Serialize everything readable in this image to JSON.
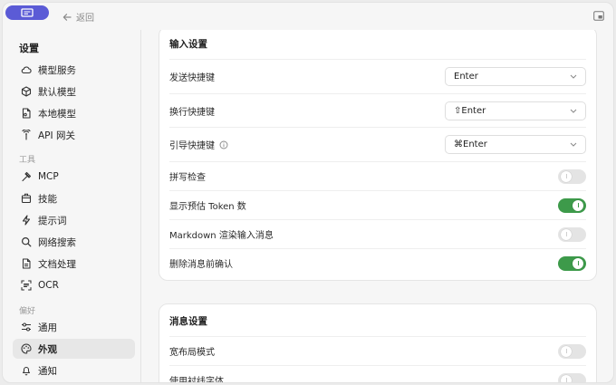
{
  "topbar": {
    "back_label": "返回"
  },
  "sidebar": {
    "title": "设置",
    "items_a": [
      {
        "label": "模型服务",
        "icon": "cloud-icon"
      },
      {
        "label": "默认模型",
        "icon": "cube-icon"
      },
      {
        "label": "本地模型",
        "icon": "document-icon"
      },
      {
        "label": "API 网关",
        "icon": "antenna-icon"
      }
    ],
    "group_tools": "工具",
    "items_b": [
      {
        "label": "MCP",
        "icon": "hammer-icon"
      },
      {
        "label": "技能",
        "icon": "box-icon"
      },
      {
        "label": "提示词",
        "icon": "lightning-icon"
      },
      {
        "label": "网络搜索",
        "icon": "search-icon"
      },
      {
        "label": "文档处理",
        "icon": "file-icon"
      },
      {
        "label": "OCR",
        "icon": "scan-icon"
      }
    ],
    "group_prefs": "偏好",
    "items_c": [
      {
        "label": "通用",
        "icon": "sliders-icon"
      },
      {
        "label": "外观",
        "icon": "palette-icon",
        "active": true
      },
      {
        "label": "通知",
        "icon": "bell-icon"
      }
    ]
  },
  "input_settings": {
    "title": "输入设置",
    "send_shortcut": {
      "label": "发送快捷键",
      "value": "Enter"
    },
    "newline_shortcut": {
      "label": "换行快捷键",
      "value": "⇧Enter"
    },
    "guide_shortcut": {
      "label": "引导快捷键",
      "value": "⌘Enter"
    },
    "spellcheck": {
      "label": "拼写检查",
      "on": false
    },
    "show_token_estimate": {
      "label": "显示预估 Token 数",
      "on": true
    },
    "markdown_render": {
      "label": "Markdown 渲染输入消息",
      "on": false
    },
    "confirm_delete": {
      "label": "删除消息前确认",
      "on": true
    }
  },
  "message_settings": {
    "title": "消息设置",
    "wide_layout": {
      "label": "宽布局模式",
      "on": false
    },
    "serif_font": {
      "label": "使用衬线字体",
      "on": false
    }
  },
  "colors": {
    "accent": "#5b5bd6",
    "toggle_on": "#3d9a4a"
  }
}
